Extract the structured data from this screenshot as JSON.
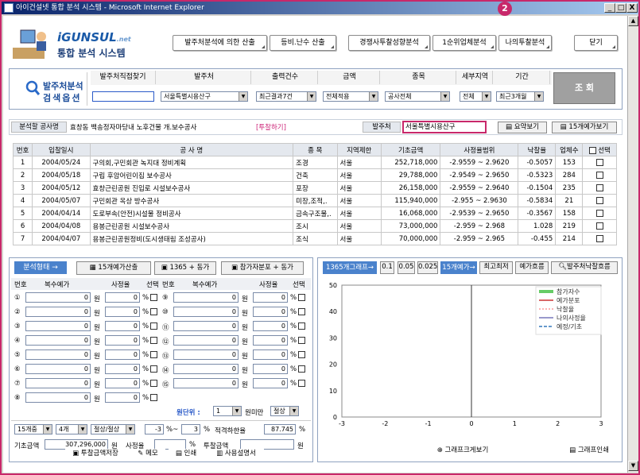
{
  "window": {
    "title": "아이건설넷 통합 분석 시스템 - Microsoft Internet Explorer",
    "min": "_",
    "max": "□",
    "close": "X",
    "annotation_badge": "2"
  },
  "logo": {
    "brand": "iGUNSUL",
    "brand_suffix": ".net",
    "title": "통합 분석 시스템"
  },
  "topnav": [
    {
      "label": "발주처분석에 의한 산출"
    },
    {
      "label": "등비.난수 산출"
    },
    {
      "label": "경쟁사투찰성향분석"
    },
    {
      "label": "1순위업체분석"
    },
    {
      "label": "나의투찰분석"
    },
    {
      "label": "닫기"
    }
  ],
  "search": {
    "title_line1": "발주처분석",
    "title_line2": "검색옵션",
    "cols": [
      "발주처직접찾기",
      "발주처",
      "출력건수",
      "금액",
      "종목",
      "세부지역",
      "기간"
    ],
    "direct_value": "",
    "orderer": "서울특별시용산구",
    "count": "최근결과7건",
    "amount": "전체적용",
    "category": "공사전체",
    "region": "전체",
    "period": "최근3개월",
    "query_button": "조 회"
  },
  "analysis": {
    "label": "분석할 공사명",
    "project": "효창동 백송정자마당내 노후건물 개.보수공사",
    "bid_link": "[투찰하기]",
    "orderer_label": "발주처",
    "orderer_value": "서울특별시용산구",
    "summary_button": "요약보기",
    "fifteen_button": "15개예가보기"
  },
  "table": {
    "headers": [
      "번호",
      "입찰일시",
      "공 사 명",
      "종 목",
      "지역제한",
      "기초금액",
      "사정율범위",
      "낙찰율",
      "업체수",
      "선택"
    ],
    "rows": [
      {
        "no": "1",
        "date": "2004/05/24",
        "name": "구의회,구민회관 녹지대 정비계획",
        "cat": "조경",
        "region": "서울",
        "base": "252,718,000",
        "range": "-2.9559 ~ 2.9620",
        "rate": "-0.5057",
        "cnt": "153"
      },
      {
        "no": "2",
        "date": "2004/05/18",
        "name": "구립 후암어린이집 보수공사",
        "cat": "건축",
        "region": "서울",
        "base": "29,788,000",
        "range": "-2.9549 ~ 2.9650",
        "rate": "-0.5323",
        "cnt": "284"
      },
      {
        "no": "3",
        "date": "2004/05/12",
        "name": "효창근린공원 진입로 시설보수공사",
        "cat": "포장",
        "region": "서울",
        "base": "26,158,000",
        "range": "-2.9559 ~ 2.9640",
        "rate": "-0.1504",
        "cnt": "235"
      },
      {
        "no": "4",
        "date": "2004/05/07",
        "name": "구민회관 옥상 방수공사",
        "cat": "미장,조적,.",
        "region": "서울",
        "base": "115,940,000",
        "range": "-2.955 ~ 2.9630",
        "rate": "-0.5834",
        "cnt": "21"
      },
      {
        "no": "5",
        "date": "2004/04/14",
        "name": "도로부속(안전)시설물 정비공사",
        "cat": "금속구조물,.",
        "region": "서울",
        "base": "16,068,000",
        "range": "-2.9539 ~ 2.9650",
        "rate": "-0.3567",
        "cnt": "158"
      },
      {
        "no": "6",
        "date": "2004/04/08",
        "name": "용봉근린공원 시설보수공사",
        "cat": "조시",
        "region": "서울",
        "base": "73,000,000",
        "range": "-2.959 ~ 2.968",
        "rate": "1.028",
        "cnt": "219"
      },
      {
        "no": "7",
        "date": "2004/04/07",
        "name": "용봉근린공원정비(도시생태림 조성공사)",
        "cat": "조식",
        "region": "서울",
        "base": "70,000,000",
        "range": "-2.959 ~ 2.965",
        "rate": "-0.455",
        "cnt": "214"
      }
    ]
  },
  "calc": {
    "tab": "분석형태 →",
    "btn1": "15개예가산출",
    "btn2": "1365 + 동가",
    "btn3": "참가자분포 + 동가",
    "headers": [
      "번호",
      "복수예가",
      "사정율",
      "선택"
    ],
    "won": "원",
    "pct": "%",
    "left_nums": [
      "①",
      "②",
      "③",
      "④",
      "⑤",
      "⑥",
      "⑦",
      "⑧"
    ],
    "right_nums": [
      "⑨",
      "⑩",
      "⑪",
      "⑫",
      "⑬",
      "⑭",
      "⑮"
    ],
    "zero": "0",
    "unit_label": "원단위 :",
    "unit_value": "1",
    "unit_suffix": "원미만",
    "round": "절상",
    "opt1": "15개중",
    "opt2": "4개",
    "opt3": "절상/절상",
    "from": "-3",
    "tilde": "%~",
    "to": "3",
    "optimal_label": "적격하한율",
    "optimal_value": "87.745",
    "base_label": "기초금액",
    "base_value": "307,296,000",
    "rate_label": "사정율",
    "bid_label": "투찰금액",
    "save_btn": "투찰금액저장",
    "memo_btn": "메모",
    "print_btn": "인쇄",
    "manual_btn": "사용설명서"
  },
  "chart_panel": {
    "tabs": [
      "1365개그래프→",
      "0.1",
      "0.05",
      "0.025",
      "15개예가→",
      "최고최저",
      "예가흐름",
      "발주처낙찰흐름"
    ],
    "zoom_btn": "그래프크게보기",
    "print_btn": "그래프인쇄"
  },
  "chart_data": {
    "type": "line",
    "title": "",
    "xlabel": "",
    "ylabel": "",
    "xlim": [
      -3,
      3
    ],
    "ylim": [
      0,
      50
    ],
    "xticks": [
      "-3",
      "-2",
      "-1",
      "0",
      "1",
      "2",
      "3"
    ],
    "yticks": [
      "0",
      "10",
      "20",
      "30",
      "40",
      "50"
    ],
    "legend_position": "top-right",
    "series": [
      {
        "name": "참가자수",
        "color": "#66cc66",
        "values": []
      },
      {
        "name": "예가분포",
        "color": "#cc3333",
        "values": []
      },
      {
        "name": "낙찰율",
        "color": "#ff6666",
        "values": []
      },
      {
        "name": "나의사정율",
        "color": "#333399",
        "values": []
      },
      {
        "name": "예정/기초",
        "color": "#6699cc",
        "values": []
      }
    ]
  }
}
